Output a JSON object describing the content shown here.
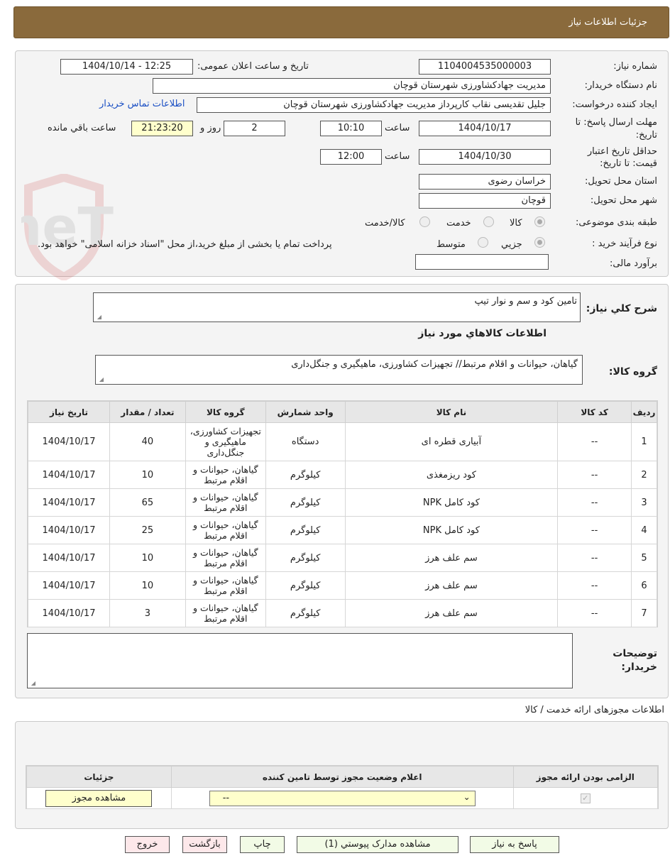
{
  "header": {
    "title": "جزئیات اطلاعات نیاز"
  },
  "form": {
    "need_number_label": "شماره نیاز:",
    "need_number": "1104004535000003",
    "announce_label": "تاریخ و ساعت اعلان عمومی:",
    "announce_value": "1404/10/14 - 12:25",
    "buyer_org_label": "نام دستگاه خریدار:",
    "buyer_org": "مدیریت جهادکشاورزی شهرستان قوچان",
    "requester_label": "ایجاد کننده درخواست:",
    "requester": "جلیل تقدیسی نقاب کارپرداز مدیریت جهادکشاورزی شهرستان قوچان",
    "contact_link": "اطلاعات تماس خریدار",
    "deadline_label_1": "مهلت ارسال پاسخ: تا",
    "deadline_label_2": "تاریخ:",
    "deadline_date": "1404/10/17",
    "time_label": "ساعت",
    "deadline_time": "10:10",
    "days_value": "2",
    "days_label": "روز و",
    "remaining_time": "21:23:20",
    "remaining_label": "ساعت باقي مانده",
    "validity_label_1": "حداقل تاریخ اعتبار",
    "validity_label_2": "قیمت: تا تاریخ:",
    "validity_date": "1404/10/30",
    "validity_time": "12:00",
    "province_label": "استان محل تحویل:",
    "province": "خراسان رضوی",
    "city_label": "شهر محل تحویل:",
    "city": "قوچان",
    "category_label": "طبقه بندی موضوعی:",
    "category_options": [
      "کالا",
      "خدمت",
      "کالا/خدمت"
    ],
    "process_label": "نوع فرآیند خرید :",
    "process_options": [
      "جزيي",
      "متوسط"
    ],
    "process_note": "پرداخت تمام یا بخشی از مبلغ خرید،از محل \"اسناد خزانه اسلامی\" خواهد بود.",
    "estimate_label": "برآورد مالی:",
    "estimate_value": ""
  },
  "needs": {
    "summary_label": "شرح کلي نياز:",
    "summary": "تامین کود و سم و نوار تیپ",
    "goods_info_title": "اطلاعات کالاهاي مورد نياز",
    "goods_group_label": "گروه کالا:",
    "goods_group": "گیاهان، حیوانات و اقلام مرتبط// تجهیزات کشاورزی، ماهیگیری و جنگل‌داری"
  },
  "goods_table": {
    "headers": [
      "رديف",
      "کد کالا",
      "نام کالا",
      "واحد شمارش",
      "گروه کالا",
      "تعداد / مقدار",
      "تاریخ نیاز"
    ],
    "rows": [
      {
        "row": "1",
        "code": "--",
        "name": "آبیاری قطره ای",
        "unit": "دستگاه",
        "group": "تجهیزات کشاورزی، ماهیگیری و جنگل‌داری",
        "qty": "40",
        "date": "1404/10/17"
      },
      {
        "row": "2",
        "code": "--",
        "name": "کود ریزمغذی",
        "unit": "کیلوگرم",
        "group": "گیاهان، حیوانات و اقلام مرتبط",
        "qty": "10",
        "date": "1404/10/17"
      },
      {
        "row": "3",
        "code": "--",
        "name": "کود کامل NPK",
        "unit": "کیلوگرم",
        "group": "گیاهان، حیوانات و اقلام مرتبط",
        "qty": "65",
        "date": "1404/10/17"
      },
      {
        "row": "4",
        "code": "--",
        "name": "کود کامل NPK",
        "unit": "کیلوگرم",
        "group": "گیاهان، حیوانات و اقلام مرتبط",
        "qty": "25",
        "date": "1404/10/17"
      },
      {
        "row": "5",
        "code": "--",
        "name": "سم علف هرز",
        "unit": "کیلوگرم",
        "group": "گیاهان، حیوانات و اقلام مرتبط",
        "qty": "10",
        "date": "1404/10/17"
      },
      {
        "row": "6",
        "code": "--",
        "name": "سم علف هرز",
        "unit": "کیلوگرم",
        "group": "گیاهان، حیوانات و اقلام مرتبط",
        "qty": "10",
        "date": "1404/10/17"
      },
      {
        "row": "7",
        "code": "--",
        "name": "سم علف هرز",
        "unit": "کیلوگرم",
        "group": "گیاهان، حیوانات و اقلام مرتبط",
        "qty": "3",
        "date": "1404/10/17"
      }
    ]
  },
  "buyer_notes": {
    "label_1": "توضیحات",
    "label_2": "خریدار:",
    "value": ""
  },
  "permits": {
    "title": "اطلاعات مجوزهای ارائه خدمت / کالا",
    "headers": [
      "الزامی بودن ارائه مجوز",
      "اعلام وضعیت مجوز توسط تامین کننده",
      "جزئیات"
    ],
    "select_value": "--",
    "view_button": "مشاهده مجوز"
  },
  "actions": {
    "reply": "پاسخ به نیاز",
    "attachments": "مشاهده مدارک پیوستي (1)",
    "print": "چاپ",
    "back": "بازگشت",
    "exit": "خروج"
  },
  "watermark": {
    "text": "AriaTender.neT"
  }
}
